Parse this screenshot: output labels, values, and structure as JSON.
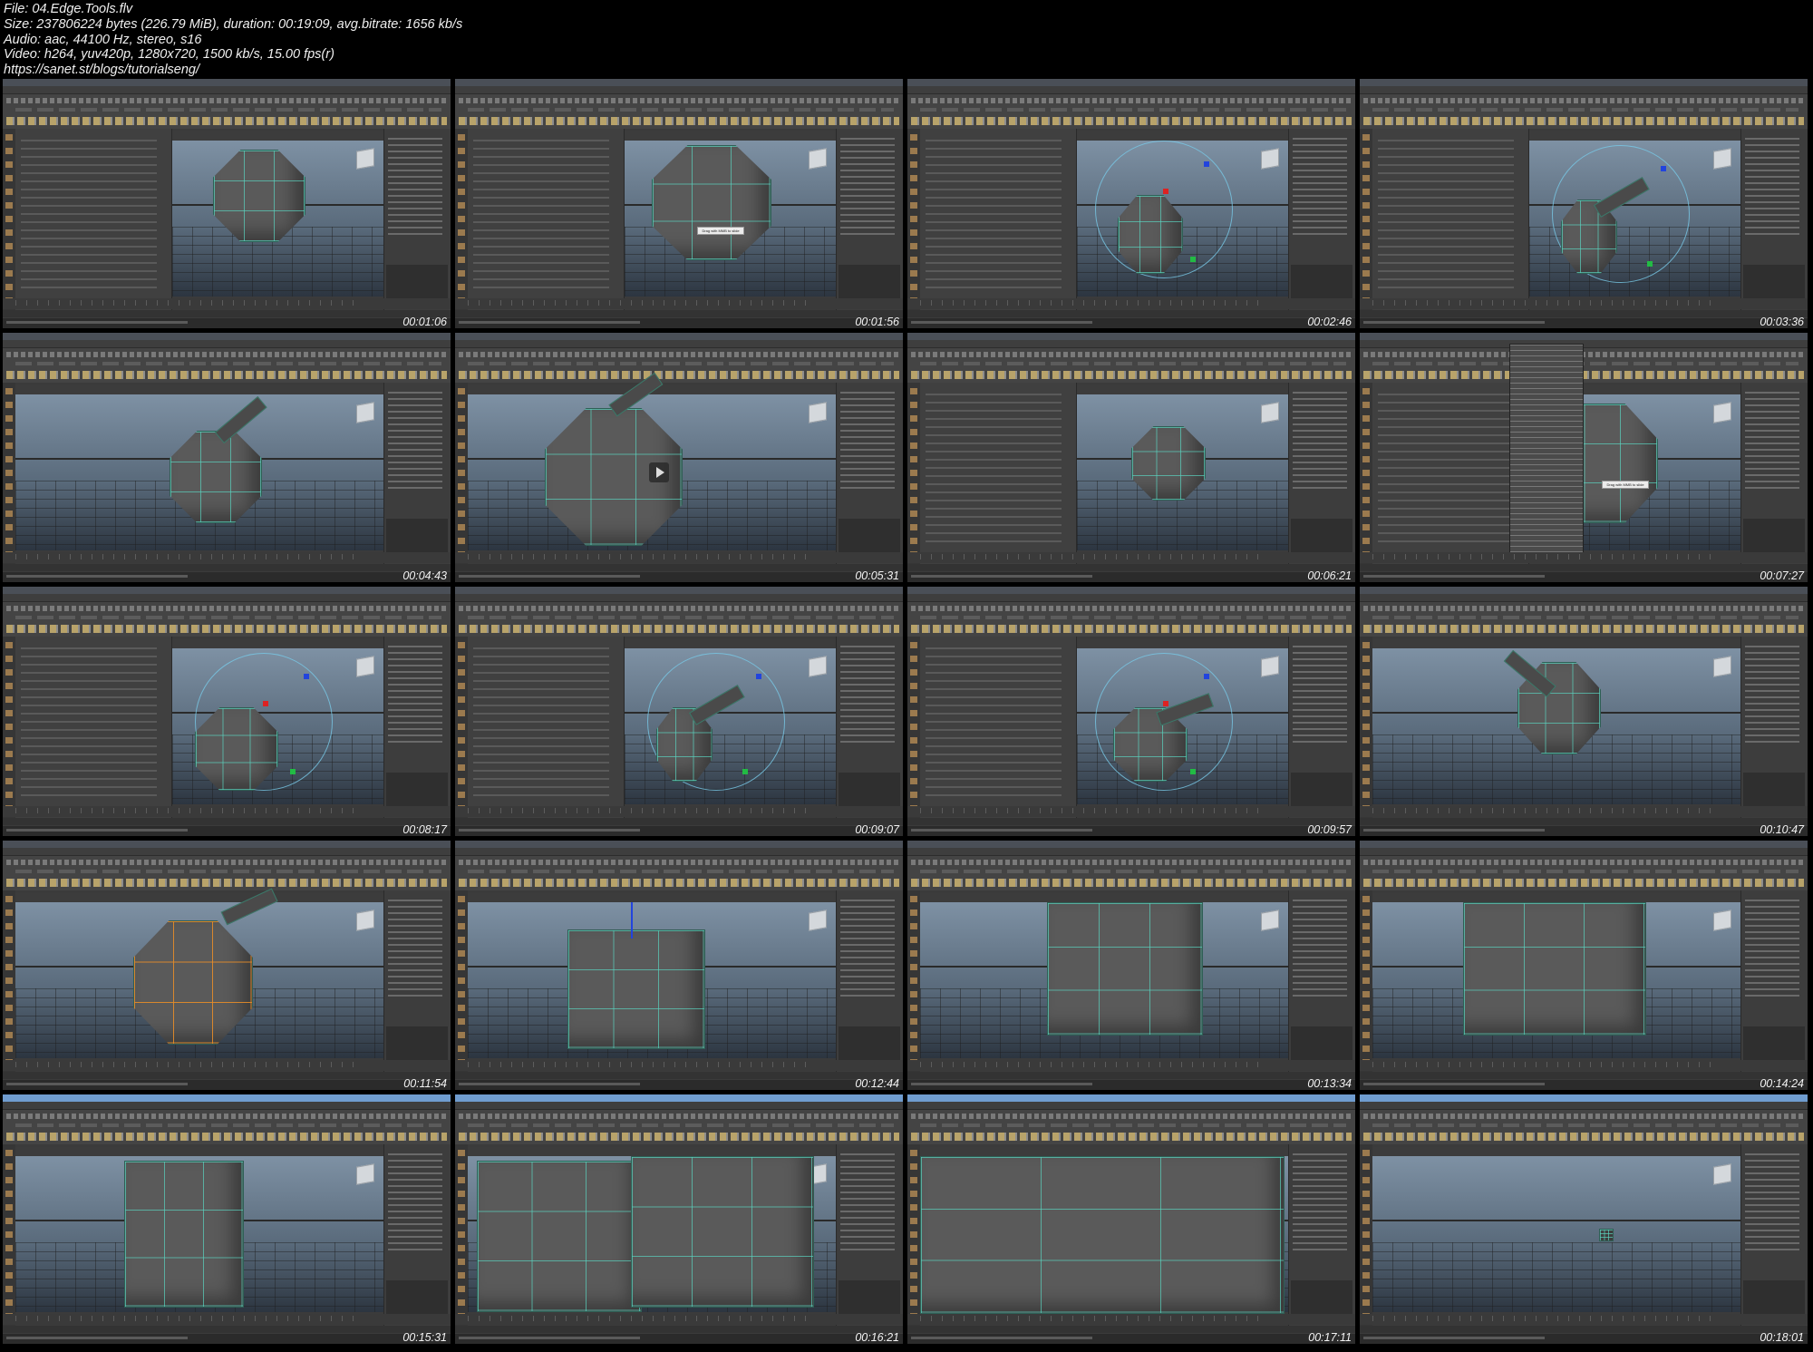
{
  "header": {
    "line1": "File: 04.Edge.Tools.flv",
    "line2": "Size: 237806224 bytes (226.79 MiB), duration: 00:19:09, avg.bitrate: 1656 kb/s",
    "line3": "Audio: aac, 44100 Hz, stereo, s16",
    "line4": "Video: h264, yuv420p, 1280x720, 1500 kb/s, 15.00 fps(r)",
    "line5": "https://sanet.st/blogs/tutorialseng/"
  },
  "thumbnails": [
    {
      "timestamp": "00:01:06",
      "scene": "polysphere-toolsettings",
      "panel": true
    },
    {
      "timestamp": "00:01:56",
      "scene": "polysphere-closeup",
      "panel": true,
      "tooltip": "Drag with MMB to slide"
    },
    {
      "timestamp": "00:02:46",
      "scene": "polysphere-manipulator",
      "panel": true
    },
    {
      "timestamp": "00:03:36",
      "scene": "extrude-manipulator",
      "panel": true
    },
    {
      "timestamp": "00:04:43",
      "scene": "polysphere-spike",
      "panel": false
    },
    {
      "timestamp": "00:05:31",
      "scene": "polysphere-spike-closeup",
      "panel": false
    },
    {
      "timestamp": "00:06:21",
      "scene": "small-sphere",
      "panel": true
    },
    {
      "timestamp": "00:07:27",
      "scene": "edit-mesh-menu",
      "panel": true,
      "tooltip": "Drag with MMB to slide"
    },
    {
      "timestamp": "00:08:17",
      "scene": "polysphere-manipulator-left",
      "panel": true
    },
    {
      "timestamp": "00:09:07",
      "scene": "extrude-manipulator",
      "panel": true
    },
    {
      "timestamp": "00:09:57",
      "scene": "extrude-flat",
      "panel": true
    },
    {
      "timestamp": "00:10:47",
      "scene": "sphere-top-spike",
      "panel": false
    },
    {
      "timestamp": "00:11:54",
      "scene": "sphere-orange-edges",
      "panel": false
    },
    {
      "timestamp": "00:12:44",
      "scene": "cube-grey",
      "panel": false
    },
    {
      "timestamp": "00:13:34",
      "scene": "cube-wire",
      "panel": false
    },
    {
      "timestamp": "00:14:24",
      "scene": "plane-large",
      "panel": false
    },
    {
      "timestamp": "00:15:31",
      "scene": "plane-side",
      "panel": false
    },
    {
      "timestamp": "00:16:21",
      "scene": "two-cubes",
      "panel": false
    },
    {
      "timestamp": "00:17:11",
      "scene": "bent-planes",
      "panel": false
    },
    {
      "timestamp": "00:18:01",
      "scene": "tiny-cube",
      "panel": false
    }
  ],
  "colors": {
    "background": "#000000",
    "header_text": "#f0f0f0",
    "maya_ui": "#3b3b3b",
    "viewport_top": "#7e91a4",
    "wire": "#5ad2be"
  },
  "icons": [
    "play-icon",
    "viewcube-icon"
  ]
}
